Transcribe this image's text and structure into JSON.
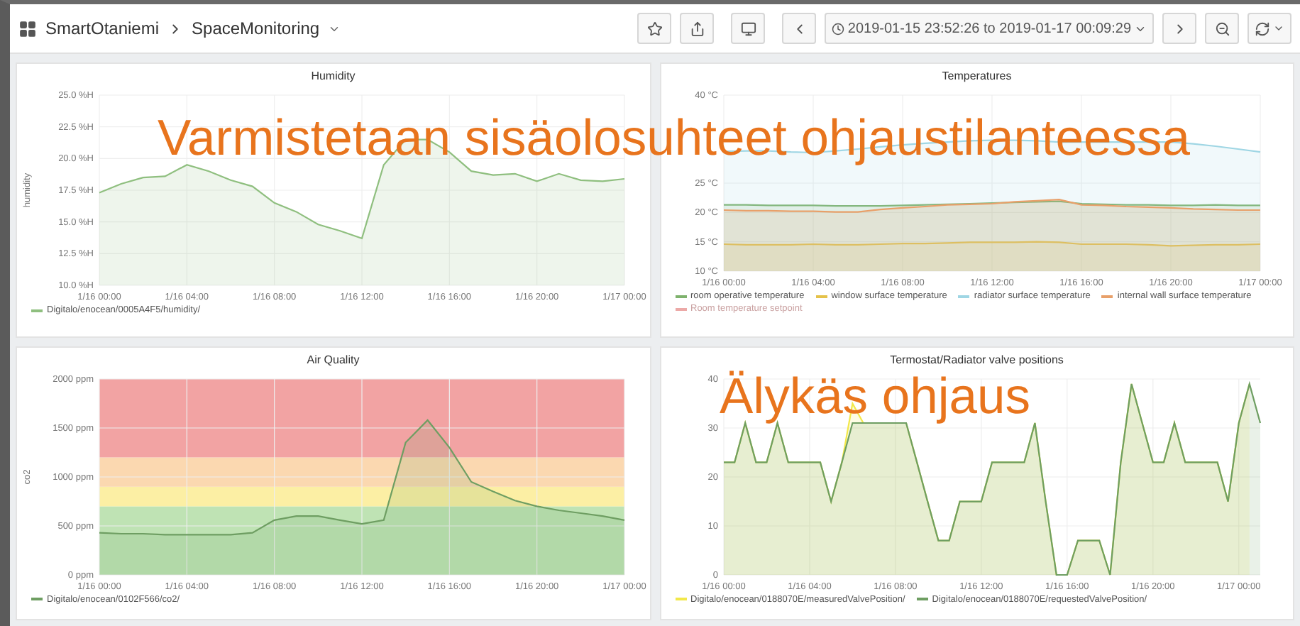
{
  "top_bar": {
    "breadcrumb": [
      {
        "label": "SmartOtaniemi"
      },
      {
        "label": "SpaceMonitoring"
      }
    ],
    "time_range": "2019-01-15 23:52:26 to 2019-01-17 00:09:29"
  },
  "panels": [
    {
      "title": "Humidity",
      "chart_data": {
        "type": "area",
        "grid": true,
        "ylabel": "humidity",
        "categories": [
          "1/16 00:00",
          null,
          null,
          null,
          "1/16 04:00",
          null,
          null,
          null,
          "1/16 08:00",
          null,
          null,
          null,
          "1/16 12:00",
          null,
          null,
          null,
          "1/16 16:00",
          null,
          null,
          null,
          "1/16 20:00",
          null,
          null,
          null,
          "1/17 00:00"
        ],
        "ylim": [
          10,
          25
        ],
        "yticks": [
          {
            "value": 10,
            "label": "10.0 %H"
          },
          {
            "value": 12.5,
            "label": "12.5 %H"
          },
          {
            "value": 15,
            "label": "15.0 %H"
          },
          {
            "value": 17.5,
            "label": "17.5 %H"
          },
          {
            "value": 20,
            "label": "20.0 %H"
          },
          {
            "value": 22.5,
            "label": "22.5 %H"
          },
          {
            "value": 25,
            "label": "25.0 %H"
          }
        ],
        "series": [
          {
            "name": "Digitalo/enocean/0005A4F5/humidity/",
            "color": "#8fbf7f",
            "values": [
              17.3,
              18,
              18.5,
              18.6,
              19.5,
              19,
              18.3,
              17.8,
              16.5,
              15.8,
              14.8,
              14.3,
              13.7,
              19.5,
              21.5,
              21.5,
              20.5,
              19,
              18.7,
              18.8,
              18.2,
              18.8,
              18.3,
              18.2,
              18.4
            ]
          }
        ]
      }
    },
    {
      "title": "Temperatures",
      "chart_data": {
        "type": "area",
        "grid": true,
        "categories": [
          "1/16 00:00",
          null,
          null,
          null,
          "1/16 04:00",
          null,
          null,
          null,
          "1/16 08:00",
          null,
          null,
          null,
          "1/16 12:00",
          null,
          null,
          null,
          "1/16 16:00",
          null,
          null,
          null,
          "1/16 20:00",
          null,
          null,
          null,
          "1/17 00:00"
        ],
        "ylim": [
          10,
          40
        ],
        "yticks": [
          {
            "value": 10,
            "label": "10 °C"
          },
          {
            "value": 15,
            "label": "15 °C"
          },
          {
            "value": 20,
            "label": "20 °C"
          },
          {
            "value": 25,
            "label": "25 °C"
          },
          {
            "value": 40,
            "label": "40 °C"
          }
        ],
        "series": [
          {
            "name": "room operative temperature",
            "color": "#7eb26d",
            "values": [
              21.3,
              21.3,
              21.2,
              21.2,
              21.2,
              21.1,
              21.1,
              21.1,
              21.2,
              21.3,
              21.4,
              21.5,
              21.6,
              21.7,
              21.8,
              21.9,
              21.5,
              21.4,
              21.3,
              21.3,
              21.2,
              21.2,
              21.3,
              21.2,
              21.2
            ]
          },
          {
            "name": "window surface temperature",
            "color": "#e5c24a",
            "values": [
              14.6,
              14.5,
              14.5,
              14.5,
              14.6,
              14.5,
              14.5,
              14.6,
              14.7,
              14.7,
              14.8,
              14.9,
              14.9,
              14.9,
              15,
              14.9,
              14.6,
              14.6,
              14.6,
              14.5,
              14.3,
              14.4,
              14.5,
              14.5,
              14.6
            ]
          },
          {
            "name": "radiator surface temperature",
            "color": "#9fd6e4",
            "values": [
              30.4,
              30.5,
              30.5,
              30.3,
              30.2,
              30.5,
              30.8,
              31.2,
              31.5,
              31.8,
              32,
              32.2,
              32.3,
              32.3,
              32.2,
              32,
              32,
              32,
              32,
              32,
              32,
              31.7,
              31.3,
              30.8,
              30.3
            ]
          },
          {
            "name": "internal wall surface temperature",
            "color": "#e8a06a",
            "values": [
              20.4,
              20.3,
              20.3,
              20.2,
              20.2,
              20.1,
              20.1,
              20.5,
              20.8,
              21,
              21.3,
              21.4,
              21.5,
              21.8,
              22,
              22.2,
              21.3,
              21.2,
              21,
              20.9,
              20.8,
              20.6,
              20.5,
              20.4,
              20.4
            ]
          },
          {
            "name": "Room temperature setpoint",
            "color": "#d9534f",
            "values": [
              null,
              null,
              null,
              null,
              null,
              null,
              null,
              null,
              null,
              null,
              null,
              null,
              null,
              null,
              null,
              null,
              null,
              null,
              null,
              null,
              null,
              null,
              null,
              null,
              null
            ]
          }
        ]
      },
      "legend_hidden": [
        false,
        false,
        false,
        false,
        true
      ]
    },
    {
      "title": "Air Quality",
      "chart_data": {
        "type": "area",
        "ylabel": "co2",
        "categories": [
          "1/16 00:00",
          null,
          null,
          null,
          "1/16 04:00",
          null,
          null,
          null,
          "1/16 08:00",
          null,
          null,
          null,
          "1/16 12:00",
          null,
          null,
          null,
          "1/16 16:00",
          null,
          null,
          null,
          "1/16 20:00",
          null,
          null,
          null,
          "1/17 00:00"
        ],
        "ylim": [
          0,
          2000
        ],
        "yticks": [
          {
            "value": 0,
            "label": "0 ppm"
          },
          {
            "value": 500,
            "label": "500 ppm"
          },
          {
            "value": 1000,
            "label": "1000 ppm"
          },
          {
            "value": 1500,
            "label": "1500 ppm"
          },
          {
            "value": 2000,
            "label": "2000 ppm"
          }
        ],
        "grid": true,
        "bands": [
          {
            "axis": "y",
            "from": 0,
            "to": 700,
            "color": "#bfe3b4"
          },
          {
            "axis": "y",
            "from": 700,
            "to": 900,
            "color": "#fcefa4"
          },
          {
            "axis": "y",
            "from": 900,
            "to": 1200,
            "color": "#fbd8b0"
          },
          {
            "axis": "y",
            "from": 1200,
            "to": 2000,
            "color": "#f2a3a3"
          }
        ],
        "series": [
          {
            "name": "Digitalo/enocean/0102F566/co2/",
            "color": "#6e9e62",
            "values": [
              430,
              420,
              420,
              410,
              410,
              410,
              410,
              430,
              560,
              600,
              600,
              560,
              520,
              560,
              1350,
              1580,
              1300,
              950,
              850,
              760,
              700,
              660,
              630,
              600,
              560
            ]
          }
        ]
      }
    },
    {
      "title": "Termostat/Radiator valve positions",
      "chart_data": {
        "type": "area",
        "grid": true,
        "categories": [
          "1/16 00:00",
          null,
          null,
          null,
          null,
          null,
          null,
          null,
          "1/16 04:00",
          null,
          null,
          null,
          null,
          null,
          null,
          null,
          "1/16 08:00",
          null,
          null,
          null,
          null,
          null,
          null,
          null,
          "1/16 12:00",
          null,
          null,
          null,
          null,
          null,
          null,
          null,
          "1/16 16:00",
          null,
          null,
          null,
          null,
          null,
          null,
          null,
          "1/16 20:00",
          null,
          null,
          null,
          null,
          null,
          null,
          null,
          "1/17 00:00",
          null,
          null
        ],
        "ylim": [
          0,
          40
        ],
        "yticks": [
          0,
          10,
          20,
          30,
          40
        ],
        "series": [
          {
            "name": "Digitalo/enocean/0188070E/measuredValvePosition/",
            "color": "#f2e84a",
            "values": [
              23,
              23,
              31,
              23,
              23,
              31,
              23,
              23,
              23,
              23,
              15,
              23,
              35,
              31,
              31,
              31,
              31,
              31,
              23,
              15,
              7,
              7,
              15,
              15,
              15,
              23,
              23,
              23,
              23,
              31,
              15,
              0,
              0,
              7,
              7,
              7,
              0,
              23,
              39,
              31,
              23,
              23,
              31,
              23,
              23,
              23,
              23,
              15,
              31,
              39,
              null
            ]
          },
          {
            "name": "Digitalo/enocean/0188070E/requestedValvePosition/",
            "color": "#6e9e62",
            "values": [
              23,
              23,
              31,
              23,
              23,
              31,
              23,
              23,
              23,
              23,
              15,
              23,
              31,
              31,
              31,
              31,
              31,
              31,
              23,
              15,
              7,
              7,
              15,
              15,
              15,
              23,
              23,
              23,
              23,
              31,
              15,
              0,
              0,
              7,
              7,
              7,
              0,
              23,
              39,
              31,
              23,
              23,
              31,
              23,
              23,
              23,
              23,
              15,
              31,
              39,
              31
            ]
          }
        ]
      }
    }
  ],
  "overlays": [
    {
      "text": "Varmistetaan sisäolosuhteet ohjaustilanteessa"
    },
    {
      "text": "Älykäs ohjaus"
    }
  ]
}
